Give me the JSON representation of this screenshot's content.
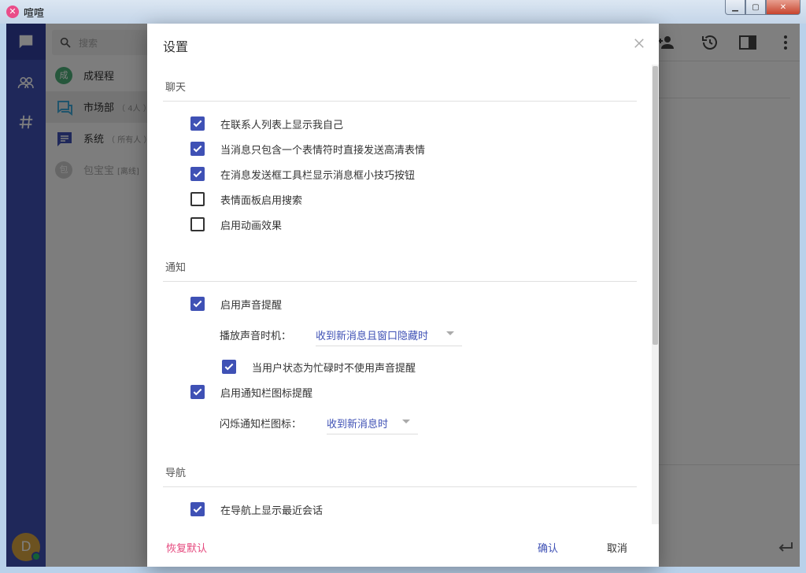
{
  "window": {
    "title": "喧喧"
  },
  "nav": {
    "items": [
      {
        "icon": "chat-icon"
      },
      {
        "icon": "contacts-icon"
      },
      {
        "icon": "hashtag-icon"
      }
    ],
    "user_initial": "D",
    "colors": {
      "bg": "#3f51b5",
      "active": "#303f9f",
      "online": "#29c16b"
    }
  },
  "sidebar": {
    "search_placeholder": "搜索",
    "chats": [
      {
        "name": "成程程",
        "sub": "",
        "avatar_text": "成",
        "avatar_color": "#4caf79"
      },
      {
        "name": "市场部",
        "sub": "（ 4人 ）",
        "icon": "group-chat-icon"
      },
      {
        "name": "系统",
        "sub": "（ 所有人 ）",
        "icon": "system-chat-icon"
      },
      {
        "name": "包宝宝",
        "sub": "[离线]",
        "avatar_text": "包",
        "avatar_color": "#cccccc"
      }
    ]
  },
  "header_icons": [
    "add-user-icon",
    "history-icon",
    "sidebar-toggle-icon",
    "more-vert-icon"
  ],
  "dialog": {
    "title": "设置",
    "sections": {
      "chat": {
        "title": "聊天",
        "options": [
          {
            "label": "在联系人列表上显示我自己",
            "checked": true
          },
          {
            "label": "当消息只包含一个表情符时直接发送高清表情",
            "checked": true
          },
          {
            "label": "在消息发送框工具栏显示消息框小技巧按钮",
            "checked": true
          },
          {
            "label": "表情面板启用搜索",
            "checked": false
          },
          {
            "label": "启用动画效果",
            "checked": false
          }
        ]
      },
      "notify": {
        "title": "通知",
        "sound": {
          "label": "启用声音提醒",
          "checked": true
        },
        "sound_timing": {
          "label": "播放声音时机：",
          "value": "收到新消息且窗口隐藏时"
        },
        "busy_mute": {
          "label": "当用户状态为忙碌时不使用声音提醒",
          "checked": true
        },
        "tray": {
          "label": "启用通知栏图标提醒",
          "checked": true
        },
        "tray_timing": {
          "label": "闪烁通知栏图标：",
          "value": "收到新消息时"
        }
      },
      "nav": {
        "title": "导航",
        "recent": {
          "label": "在导航上显示最近会话",
          "checked": true
        }
      }
    },
    "buttons": {
      "reset": "恢复默认",
      "ok": "确认",
      "cancel": "取消"
    },
    "colors": {
      "accent": "#3f51b5",
      "reset": "#e5487d"
    }
  }
}
